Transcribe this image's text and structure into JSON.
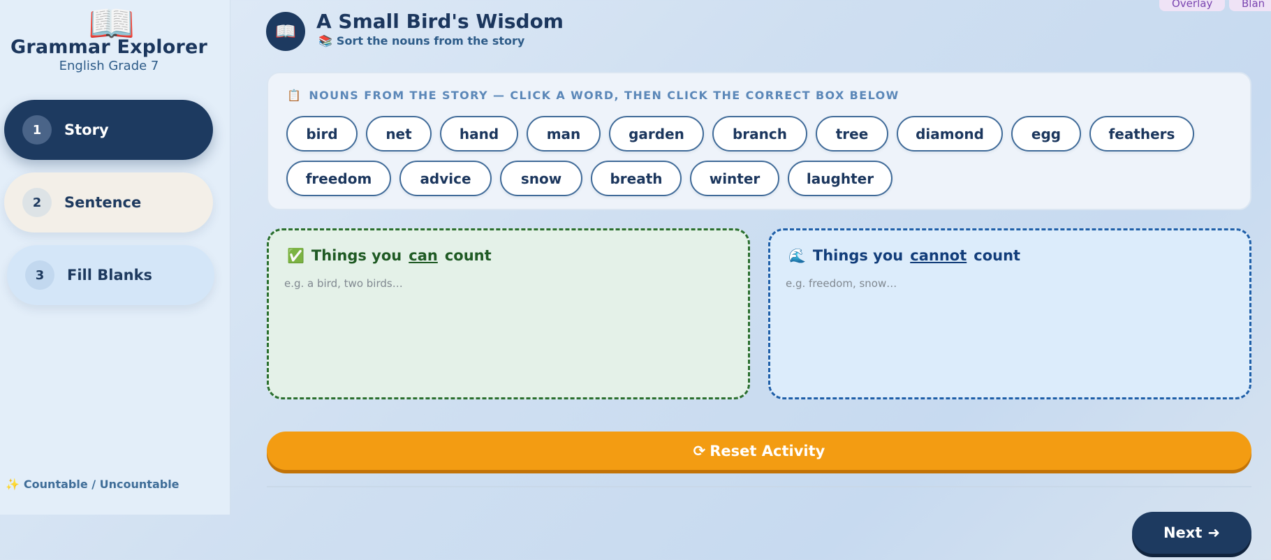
{
  "sidebar": {
    "brand_icon": "open-book-icon",
    "brand_icon_glyph": "📖",
    "title": "Grammar Explorer",
    "subtitle": "English Grade 7",
    "items": [
      {
        "num": "1",
        "label": "Story",
        "active": true
      },
      {
        "num": "2",
        "label": "Sentence",
        "active": false
      },
      {
        "num": "3",
        "label": "Fill Blanks",
        "active": false
      }
    ],
    "footer_icon_glyph": "✨",
    "footer": "Countable / Uncountable"
  },
  "top_tabs": [
    "Overlay",
    "Blan"
  ],
  "header": {
    "icon_glyph": "📖",
    "title": "A Small Bird's Wisdom",
    "subtitle_icon_glyph": "📚",
    "subtitle": "Sort the nouns from the story"
  },
  "word_bank": {
    "icon_glyph": "📋",
    "heading": "NOUNS FROM THE STORY — CLICK A WORD, THEN CLICK THE CORRECT BOX BELOW",
    "words": [
      "bird",
      "net",
      "hand",
      "man",
      "garden",
      "branch",
      "tree",
      "diamond",
      "egg",
      "feathers",
      "freedom",
      "advice",
      "snow",
      "breath",
      "winter",
      "laughter"
    ]
  },
  "zones": {
    "can": {
      "icon_glyph": "✅",
      "prefix": "Things you",
      "emphasis": "can",
      "suffix": "count",
      "hint": "e.g. a bird, two birds…"
    },
    "cannot": {
      "icon_glyph": "🌊",
      "prefix": "Things you",
      "emphasis": "cannot",
      "suffix": "count",
      "hint": "e.g. freedom, snow…"
    }
  },
  "reset": {
    "icon_glyph": "⟳",
    "label": "Reset Activity"
  },
  "next": {
    "label": "Next",
    "icon_glyph": "➜"
  },
  "colors": {
    "primary": "#1d3a60",
    "accent": "#f39c12",
    "can_border": "#2a6f2e",
    "cannot_border": "#1f5fa8"
  }
}
